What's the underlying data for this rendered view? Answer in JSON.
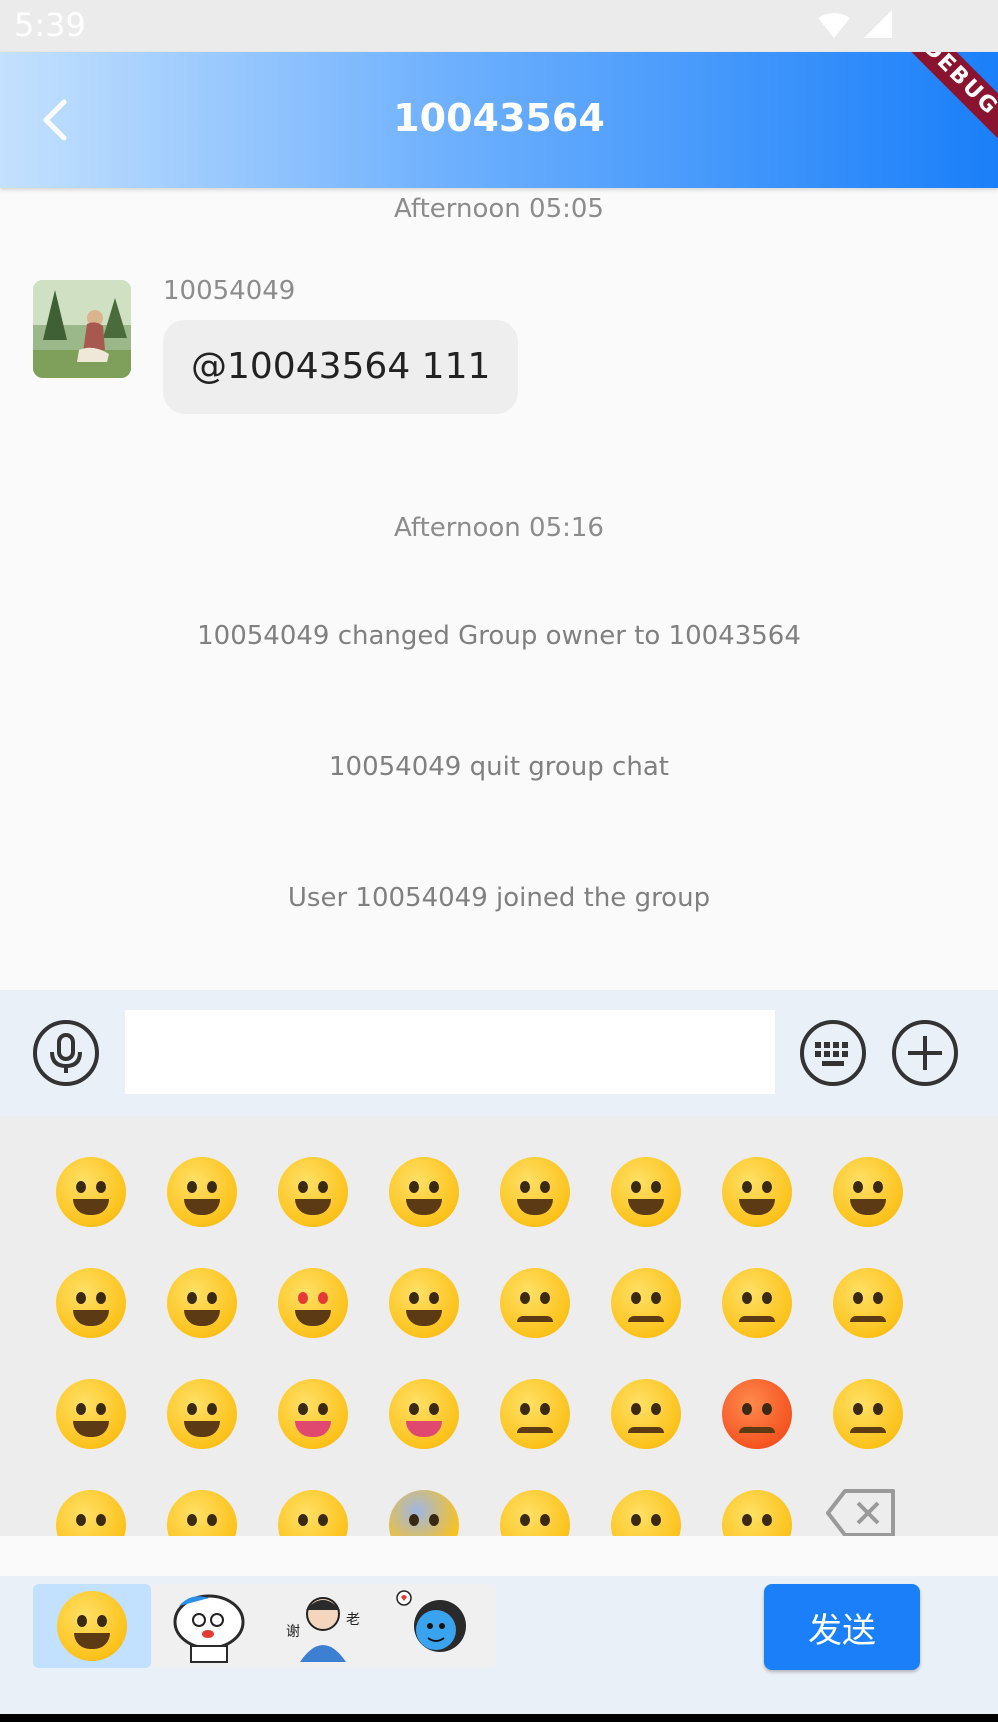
{
  "status_bar": {
    "time": "5:39"
  },
  "app_bar": {
    "title": "10043564",
    "debug_label": "DEBUG"
  },
  "messages": {
    "timestamp_1": "Afternoon 05:05",
    "sender": "10054049",
    "bubble_text": "@10043564 111",
    "timestamp_2": "Afternoon 05:16",
    "system_1": "10054049 changed Group owner to  10043564",
    "system_2": "10054049 quit group chat",
    "system_3": "User 10054049 joined the group"
  },
  "input_bar": {
    "value": "",
    "placeholder": ""
  },
  "send_button": {
    "label": "发送"
  },
  "icons": {
    "mic": "microphone-icon",
    "keyboard": "keyboard-icon",
    "plus": "plus-icon",
    "back": "back-arrow-icon",
    "delete": "backspace-icon"
  },
  "colors": {
    "accent": "#1a7ff9",
    "appbar_start": "#c4e1fd",
    "appbar_end": "#1a7ff9"
  }
}
